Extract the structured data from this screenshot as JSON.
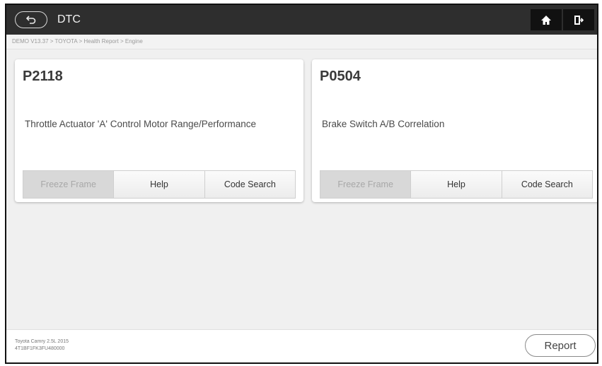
{
  "header": {
    "title": "DTC",
    "back_icon": "back-arrow-icon",
    "home_icon": "home-icon",
    "exit_icon": "exit-icon"
  },
  "breadcrumb": "DEMO V13.37 > TOYOTA > Health Report > Engine",
  "dtcs": [
    {
      "code": "P2118",
      "description": "Throttle Actuator 'A' Control Motor Range/Performance",
      "buttons": [
        "Freeze Frame",
        "Help",
        "Code Search"
      ]
    },
    {
      "code": "P0504",
      "description": "Brake Switch A/B Correlation",
      "buttons": [
        "Freeze Frame",
        "Help",
        "Code Search"
      ]
    }
  ],
  "footer": {
    "vehicle_line1": "Toyota Camry 2.5L 2015",
    "vehicle_line2": "4T1BF1FK3FU480000",
    "report_label": "Report"
  },
  "colors": {
    "topbar": "#2e2e2e",
    "disabled_button": "#d8d8d8"
  }
}
